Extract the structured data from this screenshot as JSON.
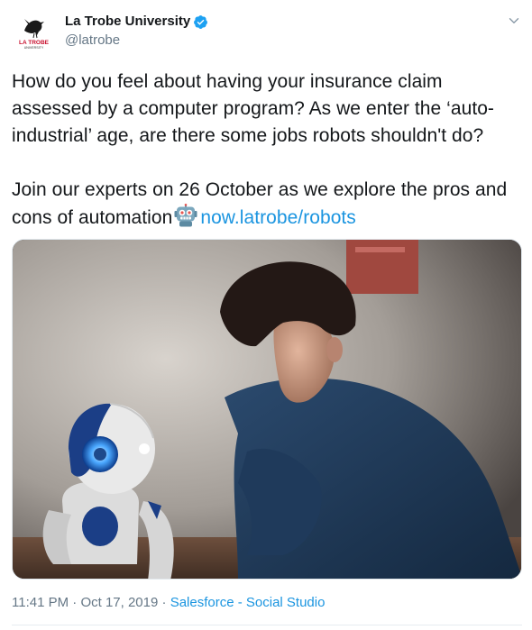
{
  "account": {
    "display_name": "La Trobe University",
    "handle": "@latrobe",
    "verified": true,
    "logo_text": "LA TROBE",
    "logo_subtext": "UNIVERSITY"
  },
  "tweet": {
    "paragraph1": "How do you feel about having your insurance claim assessed by a computer program? As we enter the ‘auto-industrial’ age, are there some jobs robots shouldn't do?",
    "paragraph2_text": "Join our experts on 26 October as we explore the pros and cons of automation",
    "emoji": "robot-face",
    "link": "now.latrobe/robots"
  },
  "meta": {
    "time": "11:41 PM",
    "separator": "·",
    "date": "Oct 17, 2019",
    "source": "Salesforce - Social Studio"
  },
  "colors": {
    "link": "#1b95e0",
    "verified": "#1da1f2",
    "text": "#14171a",
    "secondary": "#657786",
    "logo_red": "#c8102e"
  },
  "icons": {
    "verified": "verified-badge-icon",
    "menu": "chevron-down-icon",
    "emoji": "robot-face-emoji"
  }
}
